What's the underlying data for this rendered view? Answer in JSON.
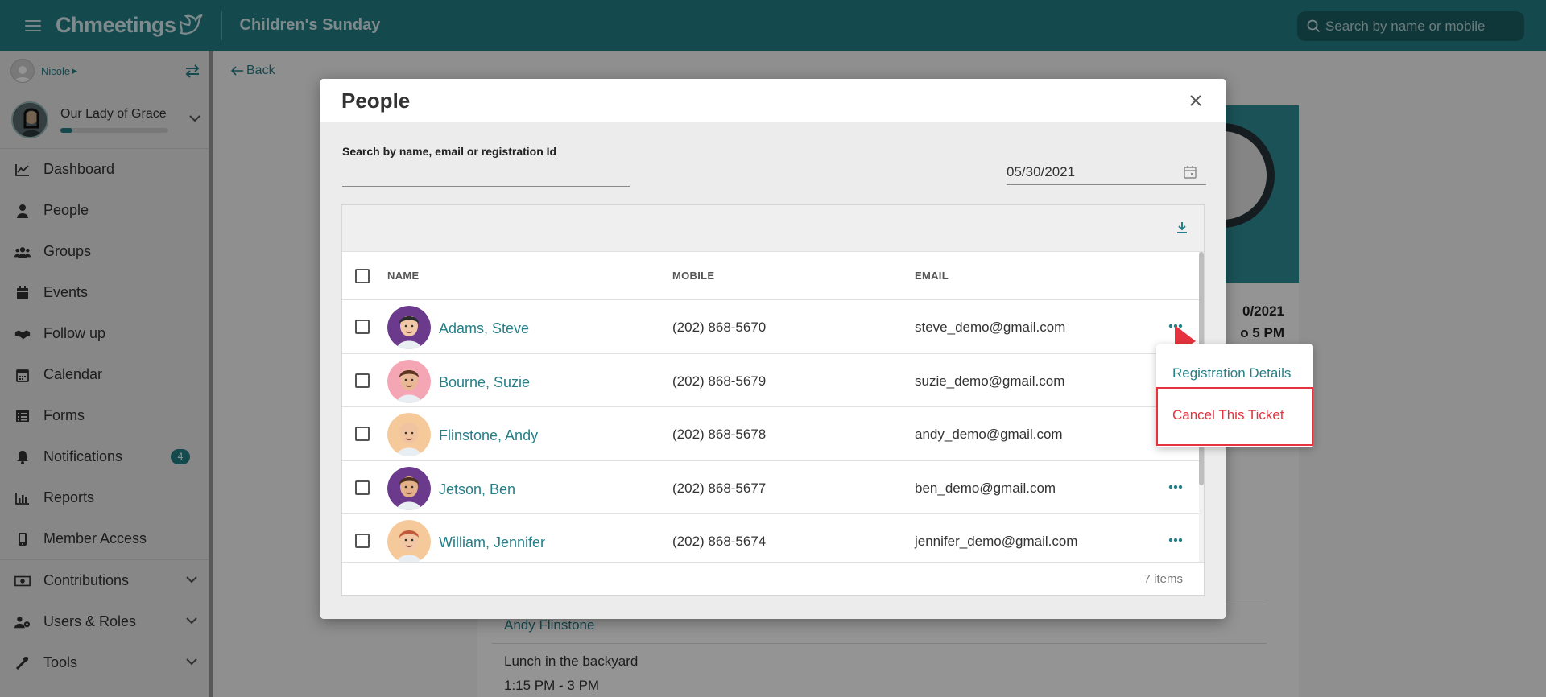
{
  "topbar": {
    "brand": "Chmeetings",
    "page_title": "Children's Sunday",
    "search_placeholder": "Search by name or mobile"
  },
  "sidebar": {
    "user": "Nicole",
    "church": "Our Lady of Grace",
    "church_progress": 0.11,
    "items": [
      {
        "label": "Dashboard",
        "icon": "chart-line-icon"
      },
      {
        "label": "People",
        "icon": "person-icon"
      },
      {
        "label": "Groups",
        "icon": "users-icon"
      },
      {
        "label": "Events",
        "icon": "calendar-icon"
      },
      {
        "label": "Follow up",
        "icon": "handshake-icon"
      },
      {
        "label": "Calendar",
        "icon": "calendar-grid-icon"
      },
      {
        "label": "Forms",
        "icon": "list-icon"
      },
      {
        "label": "Notifications",
        "icon": "bell-icon",
        "badge": "4"
      },
      {
        "label": "Reports",
        "icon": "bar-chart-icon"
      },
      {
        "label": "Member Access",
        "icon": "mobile-icon"
      },
      {
        "label": "Contributions",
        "icon": "money-icon"
      },
      {
        "label": "Users & Roles",
        "icon": "users-cog-icon"
      },
      {
        "label": "Tools",
        "icon": "tools-icon"
      }
    ]
  },
  "background": {
    "back": "Back",
    "date_line1": "0/2021",
    "date_line2": "o 5 PM",
    "organizer": "Andy Flinstone",
    "activity": "Lunch in the backyard",
    "activity_time": "1:15 PM - 3 PM"
  },
  "modal": {
    "title": "People",
    "search_label": "Search by name, email or registration Id",
    "date": "05/30/2021",
    "columns": {
      "name": "NAME",
      "mobile": "MOBILE",
      "email": "EMAIL"
    },
    "rows": [
      {
        "name": "Adams, Steve",
        "mobile": "(202) 868-5670",
        "email": "steve_demo@gmail.com"
      },
      {
        "name": "Bourne, Suzie",
        "mobile": "(202) 868-5679",
        "email": "suzie_demo@gmail.com"
      },
      {
        "name": "Flinstone, Andy",
        "mobile": "(202) 868-5678",
        "email": "andy_demo@gmail.com"
      },
      {
        "name": "Jetson, Ben",
        "mobile": "(202) 868-5677",
        "email": "ben_demo@gmail.com"
      },
      {
        "name": "William, Jennifer",
        "mobile": "(202) 868-5674",
        "email": "jennifer_demo@gmail.com"
      }
    ],
    "items_count": "7 items"
  },
  "context_menu": {
    "details": "Registration Details",
    "cancel": "Cancel This Ticket"
  },
  "colors": {
    "brand": "#247f87",
    "danger": "#e5333f"
  }
}
